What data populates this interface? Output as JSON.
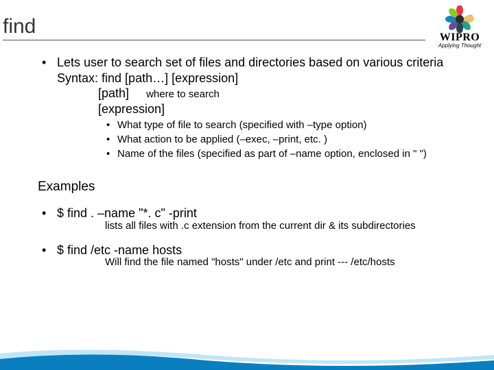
{
  "title": "find",
  "logo": {
    "name": "WIPRO",
    "tagline": "Applying Thought"
  },
  "main": {
    "intro": "Lets user to search set of files and directories based on various criteria",
    "syntax_line": "Syntax:  find [path…] [expression]",
    "path_label": "[path]",
    "path_note": "where to search",
    "expr_label": "[expression]",
    "expr_items": [
      "What type of file to search (specified with –type option)",
      "What action to be applied (–exec, –print,  etc. )",
      "Name of the files (specified as part of –name option, enclosed in \"  \")"
    ]
  },
  "examples": {
    "heading": "Examples",
    "items": [
      {
        "cmd": "$ find  .  –name \"*. c\"  -print",
        "desc": "lists all files with .c extension from the current dir & its subdirectories"
      },
      {
        "cmd": "$ find /etc -name hosts",
        "desc": "Will find the file named \"hosts\" under  /etc and print   ---  /etc/hosts"
      }
    ]
  }
}
